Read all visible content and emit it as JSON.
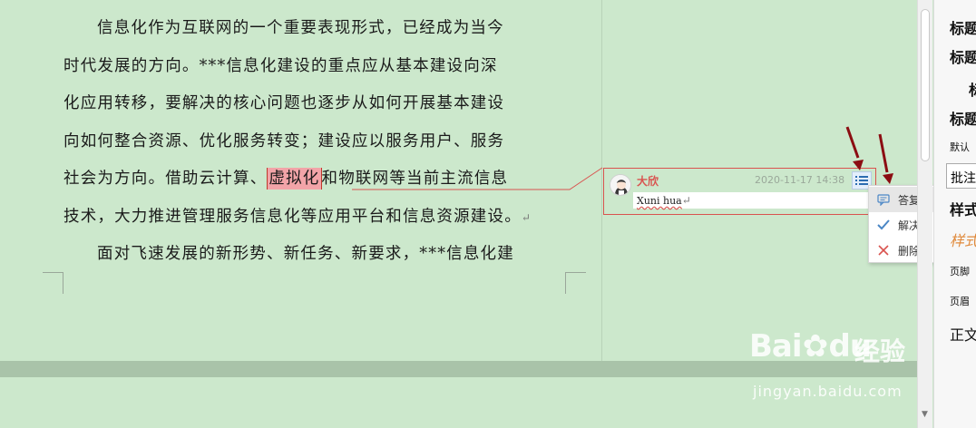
{
  "document": {
    "lines": [
      "信息化作为互联网的一个重要表现形式，已经成为当今",
      "时代发展的方向。***信息化建设的重点应从基本建设向深",
      "化应用转移，要解决的核心问题也逐步从如何开展基本建设",
      "向如何整合资源、优化服务转变；建设应以服务用户、服务"
    ],
    "line5_before": "社会为方向。借助云计算、",
    "line5_highlight": "虚拟化",
    "line5_after": "和物联网等当前主流信息",
    "line6": "技术，大力推进管理服务信息化等应用平台和信息资源建设。",
    "line6_mark": "↵",
    "line7": "面对飞速发展的新形势、新任务、新要求，***信息化建"
  },
  "comment": {
    "author": "大欣",
    "timestamp": "2020-11-17 14:38",
    "body": "Xuni hua",
    "body_mark": "↵",
    "accent_color": "#d9534f"
  },
  "context_menu": {
    "items": [
      {
        "label": "答复",
        "icon": "reply-icon"
      },
      {
        "label": "解决",
        "icon": "check-icon"
      },
      {
        "label": "删除",
        "icon": "delete-icon"
      }
    ]
  },
  "side_panel": {
    "items": [
      "标题",
      "标题",
      "标",
      "标题",
      "默认",
      "批注",
      "样式",
      "样式",
      "页脚",
      "页眉",
      "正文"
    ]
  },
  "watermark": {
    "brand": "Bai",
    "brand2": "du",
    "suffix": "经验",
    "url": "jingyan.baidu.com"
  }
}
